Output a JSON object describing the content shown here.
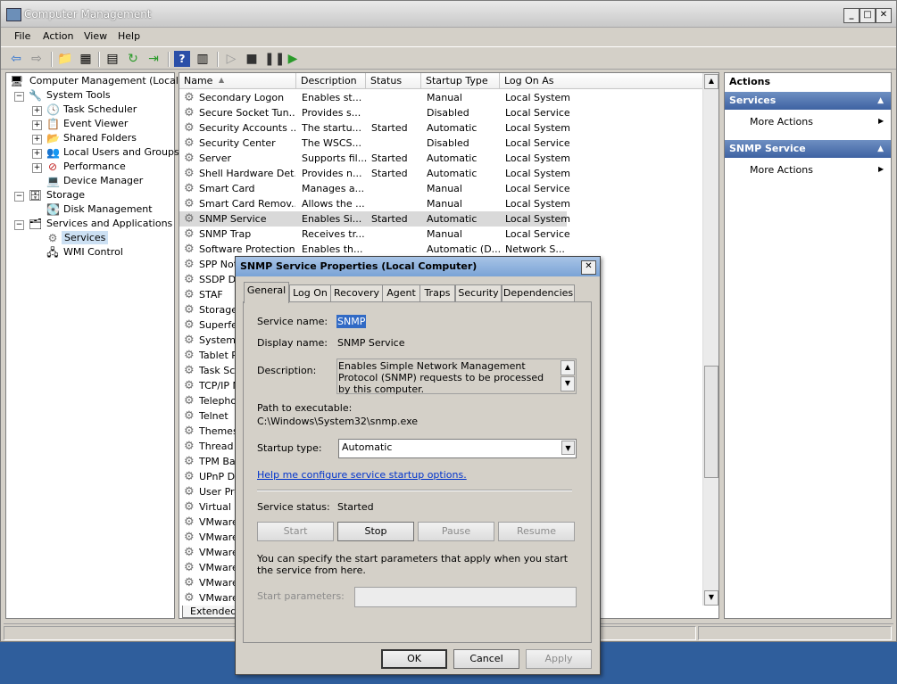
{
  "window": {
    "title": "Computer Management"
  },
  "menu": [
    "File",
    "Action",
    "View",
    "Help"
  ],
  "tree": {
    "root": "Computer Management (Local)",
    "system_tools": "System Tools",
    "task_scheduler": "Task Scheduler",
    "event_viewer": "Event Viewer",
    "shared_folders": "Shared Folders",
    "local_users": "Local Users and Groups",
    "performance": "Performance",
    "device_manager": "Device Manager",
    "storage": "Storage",
    "disk_management": "Disk Management",
    "services_apps": "Services and Applications",
    "services": "Services",
    "wmi": "WMI Control"
  },
  "list": {
    "columns": [
      "Name",
      "Description",
      "Status",
      "Startup Type",
      "Log On As"
    ],
    "rows": [
      {
        "name": "Secondary Logon",
        "desc": "Enables st...",
        "status": "",
        "startup": "Manual",
        "logon": "Local System"
      },
      {
        "name": "Secure Socket Tun...",
        "desc": "Provides s...",
        "status": "",
        "startup": "Disabled",
        "logon": "Local Service"
      },
      {
        "name": "Security Accounts ...",
        "desc": "The startu...",
        "status": "Started",
        "startup": "Automatic",
        "logon": "Local System"
      },
      {
        "name": "Security Center",
        "desc": "The WSCS...",
        "status": "",
        "startup": "Disabled",
        "logon": "Local Service"
      },
      {
        "name": "Server",
        "desc": "Supports fil...",
        "status": "Started",
        "startup": "Automatic",
        "logon": "Local System"
      },
      {
        "name": "Shell Hardware Det...",
        "desc": "Provides n...",
        "status": "Started",
        "startup": "Automatic",
        "logon": "Local System"
      },
      {
        "name": "Smart Card",
        "desc": "Manages a...",
        "status": "",
        "startup": "Manual",
        "logon": "Local Service"
      },
      {
        "name": "Smart Card Remov...",
        "desc": "Allows the ...",
        "status": "",
        "startup": "Manual",
        "logon": "Local System"
      },
      {
        "name": "SNMP Service",
        "desc": "Enables Si...",
        "status": "Started",
        "startup": "Automatic",
        "logon": "Local System"
      },
      {
        "name": "SNMP Trap",
        "desc": "Receives tr...",
        "status": "",
        "startup": "Manual",
        "logon": "Local Service"
      },
      {
        "name": "Software Protection",
        "desc": "Enables th...",
        "status": "",
        "startup": "Automatic (D...",
        "logon": "Network S..."
      },
      {
        "name": "SPP Noti",
        "desc": "",
        "status": "",
        "startup": "",
        "logon": ""
      },
      {
        "name": "SSDP Dis",
        "desc": "",
        "status": "",
        "startup": "",
        "logon": ""
      },
      {
        "name": "STAF",
        "desc": "",
        "status": "",
        "startup": "",
        "logon": ""
      },
      {
        "name": "Storage",
        "desc": "",
        "status": "",
        "startup": "",
        "logon": ""
      },
      {
        "name": "Superfet",
        "desc": "",
        "status": "",
        "startup": "",
        "logon": ""
      },
      {
        "name": "System E",
        "desc": "",
        "status": "",
        "startup": "",
        "logon": ""
      },
      {
        "name": "Tablet P",
        "desc": "",
        "status": "",
        "startup": "",
        "logon": ""
      },
      {
        "name": "Task Sch",
        "desc": "",
        "status": "",
        "startup": "",
        "logon": ""
      },
      {
        "name": "TCP/IP N",
        "desc": "",
        "status": "",
        "startup": "",
        "logon": ""
      },
      {
        "name": "Telephon",
        "desc": "",
        "status": "",
        "startup": "",
        "logon": ""
      },
      {
        "name": "Telnet",
        "desc": "",
        "status": "",
        "startup": "",
        "logon": ""
      },
      {
        "name": "Themes",
        "desc": "",
        "status": "",
        "startup": "",
        "logon": ""
      },
      {
        "name": "Thread C",
        "desc": "",
        "status": "",
        "startup": "",
        "logon": ""
      },
      {
        "name": "TPM Bas",
        "desc": "",
        "status": "",
        "startup": "",
        "logon": ""
      },
      {
        "name": "UPnP De",
        "desc": "",
        "status": "",
        "startup": "",
        "logon": ""
      },
      {
        "name": "User Pro",
        "desc": "",
        "status": "",
        "startup": "",
        "logon": ""
      },
      {
        "name": "Virtual D",
        "desc": "",
        "status": "",
        "startup": "",
        "logon": ""
      },
      {
        "name": "VMware",
        "desc": "",
        "status": "",
        "startup": "",
        "logon": ""
      },
      {
        "name": "VMware",
        "desc": "",
        "status": "",
        "startup": "",
        "logon": ""
      },
      {
        "name": "VMware",
        "desc": "",
        "status": "",
        "startup": "",
        "logon": ""
      },
      {
        "name": "VMware",
        "desc": "",
        "status": "",
        "startup": "",
        "logon": ""
      },
      {
        "name": "VMware",
        "desc": "",
        "status": "",
        "startup": "",
        "logon": ""
      },
      {
        "name": "VMware",
        "desc": "",
        "status": "",
        "startup": "",
        "logon": ""
      }
    ],
    "selected_index": 8,
    "tab_extended": "Extended"
  },
  "actions": {
    "title": "Actions",
    "section1": "Services",
    "section1_item": "More Actions",
    "section2": "SNMP Service",
    "section2_item": "More Actions"
  },
  "dialog": {
    "title": "SNMP Service Properties (Local Computer)",
    "tabs": [
      "General",
      "Log On",
      "Recovery",
      "Agent",
      "Traps",
      "Security",
      "Dependencies"
    ],
    "service_name_label": "Service name:",
    "service_name": "SNMP",
    "display_name_label": "Display name:",
    "display_name": "SNMP Service",
    "description_label": "Description:",
    "description": "Enables Simple Network Management Protocol (SNMP) requests to be processed by this computer.",
    "path_label": "Path to executable:",
    "path": "C:\\Windows\\System32\\snmp.exe",
    "startup_type_label": "Startup type:",
    "startup_type": "Automatic",
    "help_link": "Help me configure service startup options.",
    "status_label": "Service status:",
    "status": "Started",
    "start": "Start",
    "stop": "Stop",
    "pause": "Pause",
    "resume": "Resume",
    "params_text": "You can specify the start parameters that apply when you start the service from here.",
    "params_label": "Start parameters:",
    "params_value": "",
    "ok": "OK",
    "cancel": "Cancel",
    "apply": "Apply"
  }
}
